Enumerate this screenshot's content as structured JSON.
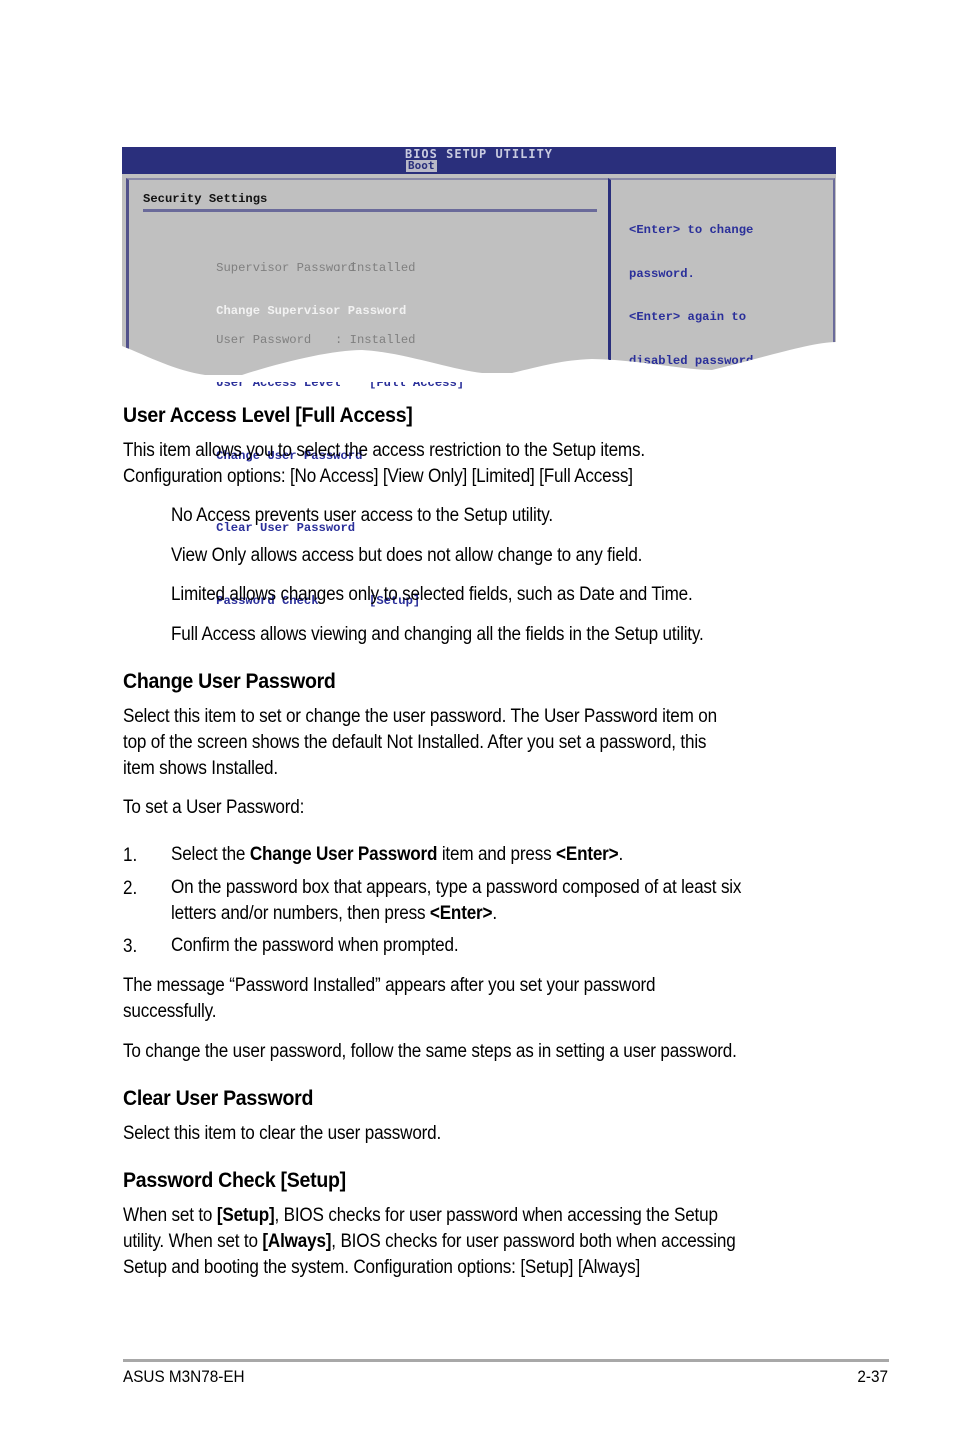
{
  "bios": {
    "title": "BIOS SETUP UTILITY",
    "active_tab": "Boot",
    "section_title": "Security Settings",
    "info_rows": [
      {
        "label": "Supervisor Password",
        "value": ": Installed"
      },
      {
        "label": "User Password",
        "value": ": Installed"
      }
    ],
    "menu_items": [
      {
        "label": "Change Supervisor Password",
        "value": ""
      },
      {
        "label": "User Access Level",
        "value": "[Full Access]"
      },
      {
        "label": "Change User Password",
        "value": ""
      },
      {
        "label": "Clear User Password",
        "value": ""
      },
      {
        "label": "Password Check",
        "value": "[Setup]"
      }
    ],
    "help_lines": [
      "<Enter> to change",
      "password.",
      "<Enter> again to",
      "disabled password."
    ],
    "colors": {
      "header": "#2a2f7c",
      "panel": "#c0c0c0",
      "menu_text": "#2a2f9a",
      "selected_text": "#f2f2f2",
      "info_text": "#7f7f7f"
    }
  },
  "sections": {
    "user_access_level": {
      "heading": "User Access Level [Full Access]",
      "lines": [
        "This item allows you to select the access restriction to the Setup items.",
        "Configuration options: [No Access] [View Only] [Limited] [Full Access]"
      ],
      "options": [
        "No Access prevents user access to the Setup utility.",
        "View Only allows access but does not allow change to any field.",
        "Limited allows changes only to selected fields, such as Date and Time.",
        "Full Access allows viewing and changing all the fields in the Setup utility."
      ]
    },
    "change_user_password": {
      "heading": "Change User Password",
      "lines": [
        "Select this item to set or change the user password. The User Password item on",
        "top of the screen shows the default Not Installed. After you set a password, this",
        "item shows Installed."
      ],
      "intro": "To set a User Password:",
      "steps": [
        {
          "num": "1.",
          "pre": "Select the ",
          "bold1": "Change User Password",
          "mid": " item and press ",
          "bold2": "<Enter>",
          "post": "."
        },
        {
          "num": "2.",
          "line1": "On the password box that appears, type a password composed of at least six",
          "pre2": "letters and/or numbers, then press ",
          "bold2": "<Enter>",
          "post2": "."
        },
        {
          "num": "3.",
          "text": "Confirm the password when prompted."
        }
      ],
      "message_lines": [
        "The message “Password Installed” appears after you set your password",
        "successfully."
      ],
      "change_note": "To change the user password, follow the same steps as in setting a user password."
    },
    "clear_user_password": {
      "heading": "Clear User Password",
      "text": "Select this item to clear the user password."
    },
    "password_check": {
      "heading": "Password Check [Setup]",
      "l1_pre": "When set to ",
      "l1_bold": "[Setup]",
      "l1_post": ", BIOS checks for user password when accessing the Setup",
      "l2_pre": "utility. When set to ",
      "l2_bold": "[Always]",
      "l2_post": ", BIOS checks for user password both when accessing",
      "l3": "Setup and booting the system. Configuration options: [Setup] [Always]"
    }
  },
  "footer": {
    "product": "ASUS M3N78-EH",
    "page": "2-37"
  }
}
